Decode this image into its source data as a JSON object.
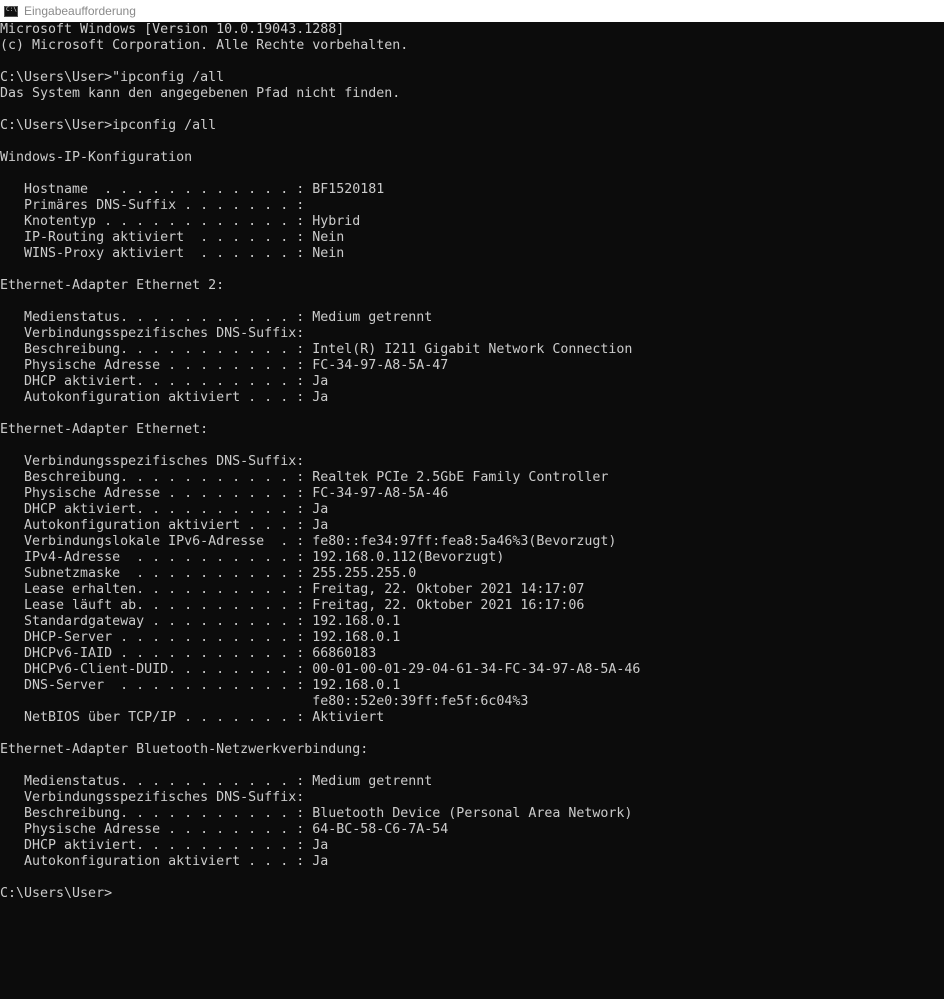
{
  "window": {
    "title": "Eingabeaufforderung",
    "icon": "cmd-icon"
  },
  "console": {
    "lines": [
      "Microsoft Windows [Version 10.0.19043.1288]",
      "(c) Microsoft Corporation. Alle Rechte vorbehalten.",
      "",
      "C:\\Users\\User>\"ipconfig /all",
      "Das System kann den angegebenen Pfad nicht finden.",
      "",
      "C:\\Users\\User>ipconfig /all",
      "",
      "Windows-IP-Konfiguration",
      "",
      "   Hostname  . . . . . . . . . . . . : BF1520181",
      "   Primäres DNS-Suffix . . . . . . . :",
      "   Knotentyp . . . . . . . . . . . . : Hybrid",
      "   IP-Routing aktiviert  . . . . . . : Nein",
      "   WINS-Proxy aktiviert  . . . . . . : Nein",
      "",
      "Ethernet-Adapter Ethernet 2:",
      "",
      "   Medienstatus. . . . . . . . . . . : Medium getrennt",
      "   Verbindungsspezifisches DNS-Suffix:",
      "   Beschreibung. . . . . . . . . . . : Intel(R) I211 Gigabit Network Connection",
      "   Physische Adresse . . . . . . . . : FC-34-97-A8-5A-47",
      "   DHCP aktiviert. . . . . . . . . . : Ja",
      "   Autokonfiguration aktiviert . . . : Ja",
      "",
      "Ethernet-Adapter Ethernet:",
      "",
      "   Verbindungsspezifisches DNS-Suffix:",
      "   Beschreibung. . . . . . . . . . . : Realtek PCIe 2.5GbE Family Controller",
      "   Physische Adresse . . . . . . . . : FC-34-97-A8-5A-46",
      "   DHCP aktiviert. . . . . . . . . . : Ja",
      "   Autokonfiguration aktiviert . . . : Ja",
      "   Verbindungslokale IPv6-Adresse  . : fe80::fe34:97ff:fea8:5a46%3(Bevorzugt)",
      "   IPv4-Adresse  . . . . . . . . . . : 192.168.0.112(Bevorzugt)",
      "   Subnetzmaske  . . . . . . . . . . : 255.255.255.0",
      "   Lease erhalten. . . . . . . . . . : Freitag, 22. Oktober 2021 14:17:07",
      "   Lease läuft ab. . . . . . . . . . : Freitag, 22. Oktober 2021 16:17:06",
      "   Standardgateway . . . . . . . . . : 192.168.0.1",
      "   DHCP-Server . . . . . . . . . . . : 192.168.0.1",
      "   DHCPv6-IAID . . . . . . . . . . . : 66860183",
      "   DHCPv6-Client-DUID. . . . . . . . : 00-01-00-01-29-04-61-34-FC-34-97-A8-5A-46",
      "   DNS-Server  . . . . . . . . . . . : 192.168.0.1",
      "                                       fe80::52e0:39ff:fe5f:6c04%3",
      "   NetBIOS über TCP/IP . . . . . . . : Aktiviert",
      "",
      "Ethernet-Adapter Bluetooth-Netzwerkverbindung:",
      "",
      "   Medienstatus. . . . . . . . . . . : Medium getrennt",
      "   Verbindungsspezifisches DNS-Suffix:",
      "   Beschreibung. . . . . . . . . . . : Bluetooth Device (Personal Area Network)",
      "   Physische Adresse . . . . . . . . : 64-BC-58-C6-7A-54",
      "   DHCP aktiviert. . . . . . . . . . : Ja",
      "   Autokonfiguration aktiviert . . . : Ja",
      "",
      "C:\\Users\\User>"
    ]
  }
}
